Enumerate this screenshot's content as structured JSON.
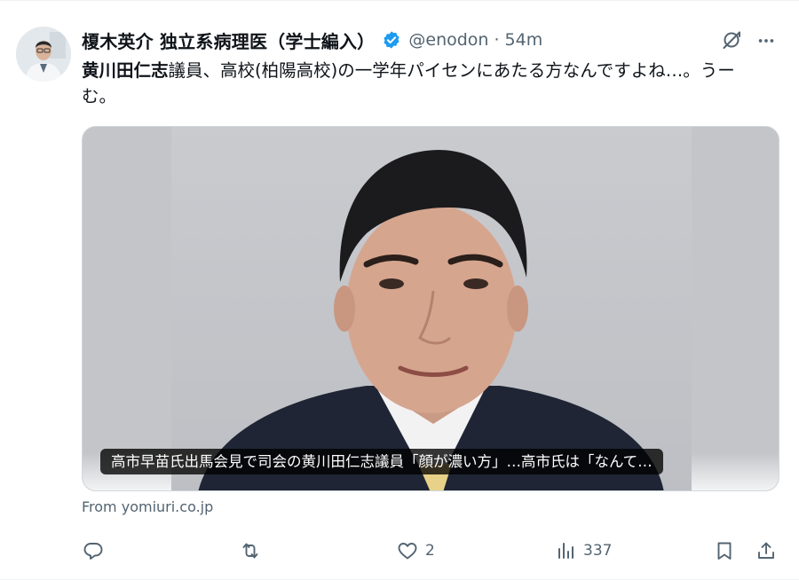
{
  "tweet": {
    "author": {
      "display_name": "榎木英介 独立系病理医（学士編入）",
      "handle": "@enodon",
      "separator": "·",
      "time": "54m",
      "verified": true,
      "verified_color": "#1d9bf0"
    },
    "text": {
      "mention": "黄川田仁志",
      "rest": "議員、高校(柏陽高校)の一学年パイセンにあたる方なんですよね…。うーむ。"
    },
    "card": {
      "caption": "高市早苗氏出馬会見で司会の黄川田仁志議員「顔が濃い方」…高市氏は「なんて…",
      "source": "From yomiuri.co.jp"
    },
    "actions": {
      "reply": {
        "icon": "reply-icon",
        "count": ""
      },
      "retweet": {
        "icon": "retweet-icon",
        "count": ""
      },
      "like": {
        "icon": "heart-icon",
        "count": "2"
      },
      "views": {
        "icon": "views-icon",
        "count": "337"
      },
      "bookmark": {
        "icon": "bookmark-icon"
      },
      "share": {
        "icon": "share-icon"
      }
    }
  },
  "colors": {
    "text": "#0f1419",
    "muted": "#536471",
    "border": "#cfd9de",
    "accent": "#1d9bf0"
  }
}
